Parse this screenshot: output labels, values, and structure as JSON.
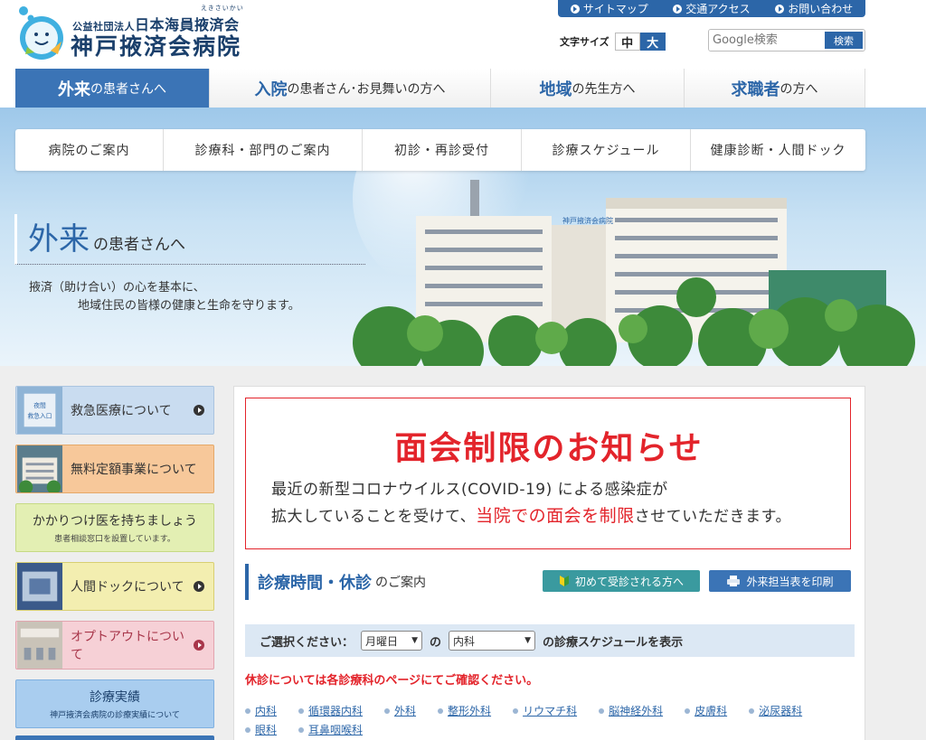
{
  "header": {
    "corp_type": "公益社団法人",
    "corp_name": "日本海員掖済会",
    "corp_ruby": "えきさいかい",
    "hospital_name": "神戸掖済会病院"
  },
  "utility": {
    "items": [
      "サイトマップ",
      "交通アクセス",
      "お問い合わせ"
    ]
  },
  "fontsize": {
    "label": "文字サイズ",
    "medium": "中",
    "large": "大"
  },
  "search": {
    "placeholder": "Google検索",
    "button": "検索"
  },
  "global_nav": [
    {
      "em": "外来",
      "rest": "の患者さんへ"
    },
    {
      "em": "入院",
      "rest": "の患者さん･お見舞いの方へ"
    },
    {
      "em": "地域",
      "rest": "の先生方へ"
    },
    {
      "em": "求職者",
      "rest": "の方へ"
    }
  ],
  "sub_nav": [
    "病院のご案内",
    "診療科・部門のご案内",
    "初診・再診受付",
    "診療スケジュール",
    "健康診断・人間ドック"
  ],
  "hero": {
    "title_em": "外来",
    "title_rest": "の患者さんへ",
    "copy1": "掖済（助け合い）の心を基本に、",
    "copy2": "地域住民の皆様の健康と生命を守ります。",
    "building_sign": "神戸掖済会病院"
  },
  "sidebar": {
    "banners": [
      {
        "label": "救急医療について",
        "thumb_text": "夜間救急入口"
      },
      {
        "label": "無料定額事業について"
      },
      {
        "label": "かかりつけ医を持ちましょう",
        "sub": "患者相談窓口を設置しています。"
      },
      {
        "label": "人間ドックについて"
      },
      {
        "label": "オプトアウトについて"
      },
      {
        "label": "診療実績",
        "sub": "神戸掖済会病院の診療実績について"
      }
    ]
  },
  "notice": {
    "title": "面会制限のお知らせ",
    "line1": "最近の新型コロナウイルス(COVID-19) による感染症が",
    "line2_a": "拡大していることを受けて、",
    "line2_red": "当院での面会を制限",
    "line2_b": "させていただきます。"
  },
  "schedule": {
    "heading_em": "診療時間・休診",
    "heading_rest": "のご案内",
    "first_visit_button": "初めて受診される方へ",
    "print_button": "外来担当表を印刷",
    "select_label": "ご選択ください：",
    "day_value": "月曜日",
    "connector": "の",
    "dept_value": "内科",
    "select_suffix": "の診療スケジュールを表示",
    "holiday_note": "休診については各診療科のページにてご確認ください。",
    "departments": [
      "内科",
      "循環器内科",
      "外科",
      "整形外科",
      "リウマチ科",
      "脳神経外科",
      "皮膚科",
      "泌尿器科",
      "眼科",
      "耳鼻咽喉科"
    ]
  },
  "colors": {
    "brand_blue": "#2c66a8",
    "alert_red": "#e3242b",
    "accent_teal": "#3a9a9f"
  }
}
